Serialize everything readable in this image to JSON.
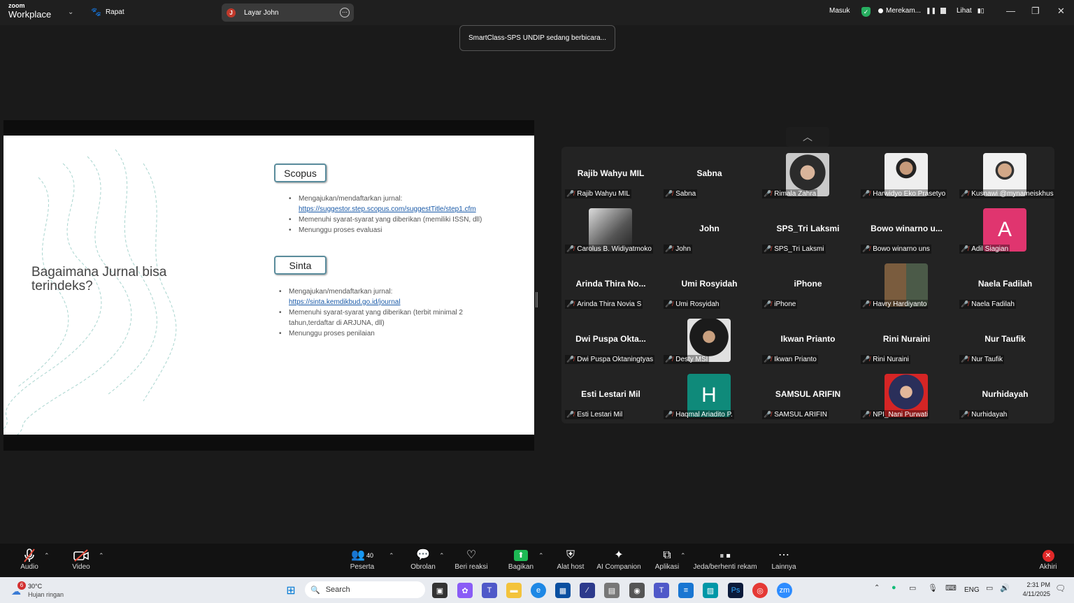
{
  "app": {
    "brand_top": "zoom",
    "brand_bottom": "Workplace",
    "meeting_label": "Rapat"
  },
  "screen_share": {
    "initial": "J",
    "label": "Layar John"
  },
  "topbar_right": {
    "signin": "Masuk",
    "recording": "Merekam...",
    "view": "Lihat"
  },
  "speaking_banner": "SmartClass-SPS UNDIP sedang berbicara...",
  "slide": {
    "title": "Bagaimana Jurnal bisa terindeks?",
    "scopus": {
      "heading": "Scopus",
      "bullet1": "Mengajukan/mendaftarkan jurnal:",
      "link": "https://suggestor.step.scopus.com/suggestTitle/step1.cfm",
      "bullet2": "Memenuhi syarat-syarat yang diberikan (memiliki ISSN, dll)",
      "bullet3": "Menunggu proses evaluasi"
    },
    "sinta": {
      "heading": "Sinta",
      "bullet1": "Mengajukan/mendaftarkan jurnal:",
      "link": "https://sinta.kemdikbud.go.id/journal",
      "bullet2a": "Memenuhi syarat-syarat yang diberikan (terbit minimal 2",
      "bullet2b": "tahun,terdaftar di ARJUNA, dll)",
      "bullet3": "Menunggu proses penilaian"
    }
  },
  "participants": [
    {
      "name": "Rajib Wahyu MIL",
      "label": "Rajib Wahyu MIL"
    },
    {
      "name": "Sabna",
      "label": "Sabna"
    },
    {
      "photo": "hijab-woman",
      "label": "Rimala Zahra"
    },
    {
      "photo": "man-suit",
      "label": "Harwidyo Eko Prasetyo"
    },
    {
      "photo": "man-glasses",
      "label": "Kusnawi @mynameiskhus"
    },
    {
      "photo": "bw-portrait",
      "label": "Carolus B. Widiyatmoko"
    },
    {
      "name": "John",
      "label": "John"
    },
    {
      "name": "SPS_Tri Laksmi",
      "label": "SPS_Tri Laksmi"
    },
    {
      "name": "Bowo winarno u...",
      "label": "Bowo winarno uns"
    },
    {
      "letter": "A",
      "color": "#e0356f",
      "label": "Adil Siagian"
    },
    {
      "name": "Arinda Thira No...",
      "label": "Arinda Thira Novia S"
    },
    {
      "name": "Umi Rosyidah",
      "label": "Umi Rosyidah"
    },
    {
      "name": "iPhone",
      "label": "iPhone"
    },
    {
      "photo": "couple",
      "label": "Havry Hardiyanto"
    },
    {
      "name": "Naela Fadilah",
      "label": "Naela Fadilah"
    },
    {
      "name": "Dwi Puspa Okta...",
      "label": "Dwi Puspa Oktaningtyas"
    },
    {
      "photo": "hijab-woman-2",
      "label": "Desty MSI"
    },
    {
      "name": "Ikwan Prianto",
      "label": "Ikwan Prianto"
    },
    {
      "name": "Rini Nuraini",
      "label": "Rini Nuraini"
    },
    {
      "name": "Nur Taufik",
      "label": "Nur Taufik"
    },
    {
      "name": "Esti Lestari Mil",
      "label": "Esti Lestari Mil"
    },
    {
      "letter": "H",
      "color": "#0f8a7a",
      "label": "Haqmal Ariadito P."
    },
    {
      "name": "SAMSUL ARIFIN",
      "label": "SAMSUL ARIFIN"
    },
    {
      "photo": "hijab-red",
      "label": "NPI_Nani Purwati"
    },
    {
      "name": "Nurhidayah",
      "label": "Nurhidayah"
    }
  ],
  "toolbar": {
    "audio": "Audio",
    "video": "Video",
    "participants": "Peserta",
    "participants_count": "40",
    "chat": "Obrolan",
    "react": "Beri reaksi",
    "share": "Bagikan",
    "host_tools": "Alat host",
    "ai": "AI Companion",
    "apps": "Aplikasi",
    "pause_record": "Jeda/berhenti rekam",
    "more": "Lainnya",
    "end": "Akhiri"
  },
  "taskbar": {
    "weather_temp": "30°C",
    "weather_desc": "Hujan ringan",
    "weather_badge": "6",
    "search": "Search",
    "lang": "ENG",
    "time": "2:31 PM",
    "date": "4/11/2025"
  },
  "colors": {
    "accent_green": "#27ae60",
    "share_green": "#1db954",
    "end_red": "#e02828"
  }
}
